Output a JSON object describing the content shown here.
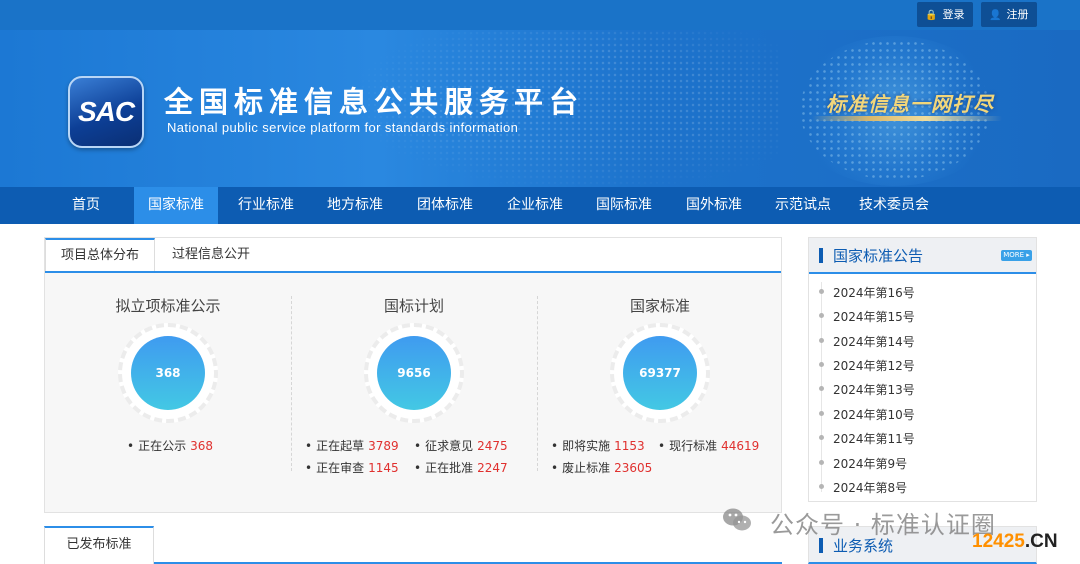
{
  "topbar": {
    "login": "登录",
    "register": "注册"
  },
  "banner": {
    "logo_text": "SAC",
    "title": "全国标准信息公共服务平台",
    "subtitle": "National public service platform  for standards information",
    "slogan": "标准信息一网打尽"
  },
  "nav": [
    "首页",
    "国家标准",
    "行业标准",
    "地方标准",
    "团体标准",
    "企业标准",
    "国际标准",
    "国外标准",
    "示范试点",
    "技术委员会"
  ],
  "nav_active": "国家标准",
  "overview": {
    "tabs": [
      "项目总体分布",
      "过程信息公开"
    ],
    "active_tab": "项目总体分布",
    "columns": [
      {
        "title": "拟立项标准公示",
        "total": "368",
        "stats": [
          {
            "label": "正在公示",
            "value": "368"
          }
        ]
      },
      {
        "title": "国标计划",
        "total": "9656",
        "stats": [
          {
            "label": "正在起草",
            "value": "3789"
          },
          {
            "label": "征求意见",
            "value": "2475"
          },
          {
            "label": "正在审查",
            "value": "1145"
          },
          {
            "label": "正在批准",
            "value": "2247"
          }
        ]
      },
      {
        "title": "国家标准",
        "total": "69377",
        "stats": [
          {
            "label": "即将实施",
            "value": "1153"
          },
          {
            "label": "现行标准",
            "value": "44619"
          },
          {
            "label": "废止标准",
            "value": "23605"
          }
        ]
      }
    ]
  },
  "published": {
    "tab": "已发布标准"
  },
  "announcements": {
    "title": "国家标准公告",
    "more": "MORE ▸",
    "items": [
      "2024年第16号",
      "2024年第15号",
      "2024年第14号",
      "2024年第12号",
      "2024年第13号",
      "2024年第10号",
      "2024年第11号",
      "2024年第9号",
      "2024年第8号"
    ]
  },
  "business": {
    "title": "业务系统"
  },
  "watermark": {
    "text": "公众号 · 标准认证圈",
    "site_a": "12425",
    "site_b": ".CN"
  },
  "colors": {
    "nav": "#0d5cb2",
    "accent": "#2c8ee8",
    "number_red": "#e0312f"
  }
}
